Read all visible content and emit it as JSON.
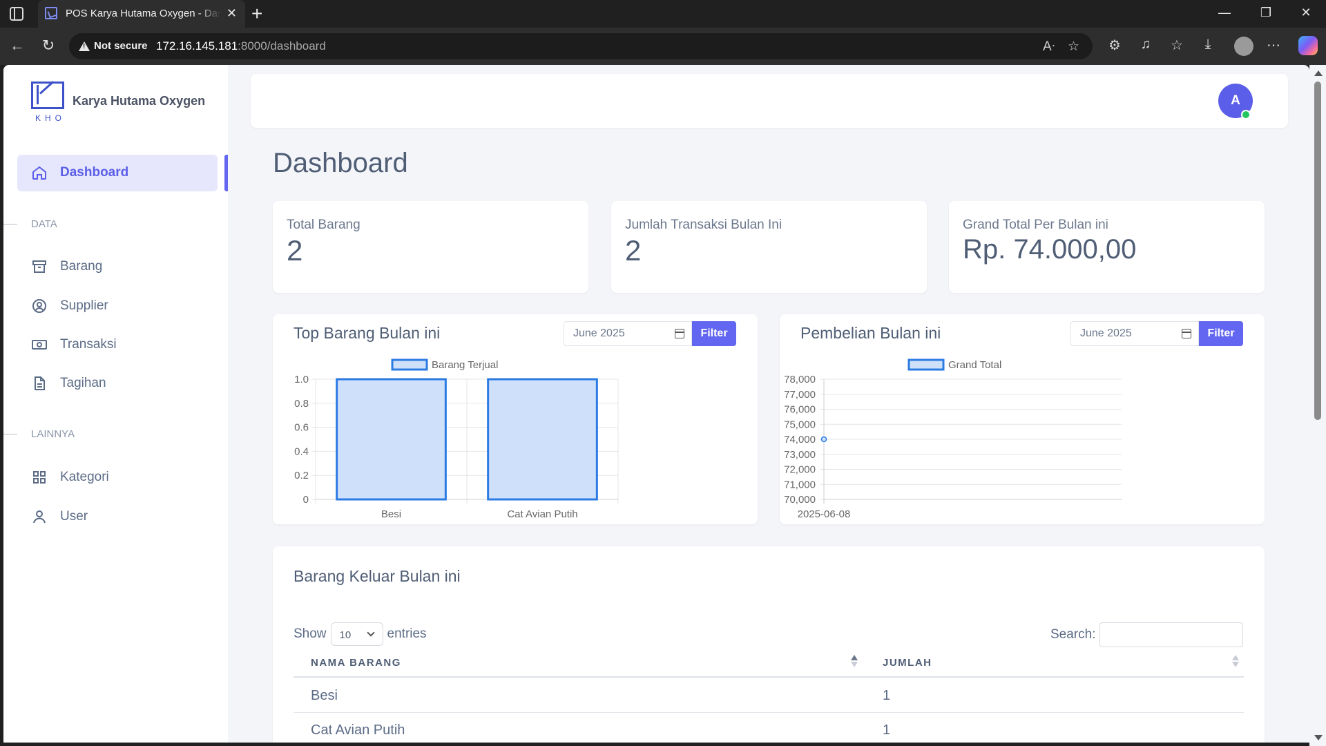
{
  "browser": {
    "tab_title": "POS Karya Hutama Oxygen - Dashboard",
    "tab_close": "✕",
    "new_tab": "+",
    "security_label": "Not secure",
    "url_host": "172.16.145.181",
    "url_path": ":8000/dashboard",
    "window_controls": [
      "—",
      "❐",
      "✕"
    ]
  },
  "sidebar": {
    "logo_text": "KHO",
    "brand": "Karya Hutama Oxygen",
    "active_item": {
      "label": "Dashboard",
      "icon": "home-icon"
    },
    "section_data": "DATA",
    "data_items": [
      {
        "label": "Barang",
        "icon": "archive-icon"
      },
      {
        "label": "Supplier",
        "icon": "user-circle-icon"
      },
      {
        "label": "Transaksi",
        "icon": "cash-icon"
      },
      {
        "label": "Tagihan",
        "icon": "document-icon"
      }
    ],
    "section_other": "LAINNYA",
    "other_items": [
      {
        "label": "Kategori",
        "icon": "grid-icon"
      },
      {
        "label": "User",
        "icon": "user-icon"
      }
    ]
  },
  "header": {
    "avatar_initial": "A",
    "online": true
  },
  "page": {
    "title": "Dashboard"
  },
  "stats": [
    {
      "label": "Total Barang",
      "value": "2"
    },
    {
      "label": "Jumlah Transaksi Bulan Ini",
      "value": "2"
    },
    {
      "label": "Grand Total Per Bulan ini",
      "value": "Rp. 74.000,00"
    }
  ],
  "charts": {
    "top_barang": {
      "title": "Top Barang Bulan ini",
      "filter_value": "June 2025",
      "filter_label": "Filter"
    },
    "pembelian": {
      "title": "Pembelian Bulan ini",
      "filter_value": "June 2025",
      "filter_label": "Filter"
    }
  },
  "chart_data": [
    {
      "type": "bar",
      "title": "Top Barang Bulan ini",
      "categories": [
        "Besi",
        "Cat Avian Putih"
      ],
      "series": [
        {
          "name": "Barang Terjual",
          "values": [
            1,
            1
          ]
        }
      ],
      "ylim": [
        0,
        1.0
      ],
      "yticks": [
        "0",
        "0.2",
        "0.4",
        "0.6",
        "0.8",
        "1.0"
      ],
      "legend": "top-center",
      "grid": true,
      "colors": {
        "fill": "#cfe0fb",
        "stroke": "#2b7be3"
      }
    },
    {
      "type": "line",
      "title": "Pembelian Bulan ini",
      "x": [
        "2025-06-08"
      ],
      "series": [
        {
          "name": "Grand Total",
          "values": [
            74000
          ]
        }
      ],
      "ylim": [
        70000,
        78000
      ],
      "yticks": [
        "70,000",
        "71,000",
        "72,000",
        "73,000",
        "74,000",
        "75,000",
        "76,000",
        "77,000",
        "78,000"
      ],
      "legend": "top-center",
      "grid": true,
      "colors": {
        "fill": "#cfe0fb",
        "stroke": "#2b7be3"
      }
    }
  ],
  "table": {
    "title": "Barang Keluar Bulan ini",
    "show_label": "Show",
    "page_size": "10",
    "entries_label": "entries",
    "search_label": "Search:",
    "columns": [
      "NAMA BARANG",
      "JUMLAH"
    ],
    "rows": [
      [
        "Besi",
        "1"
      ],
      [
        "Cat Avian Putih",
        "1"
      ]
    ]
  },
  "colors": {
    "accent": "#6366f1",
    "text": "#4f5d75",
    "online": "#22c55e"
  }
}
